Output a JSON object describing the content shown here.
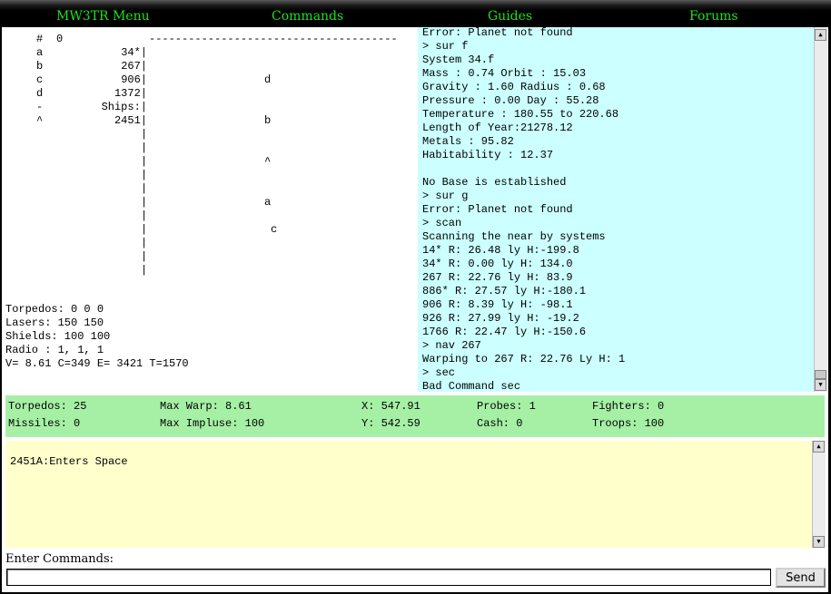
{
  "menu": {
    "items": [
      {
        "label": "MW3TR Menu"
      },
      {
        "label": "Commands"
      },
      {
        "label": "Guides"
      },
      {
        "label": "Forums"
      }
    ]
  },
  "map": {
    "header_hash": "#",
    "header_zero": "0",
    "header_dashes": "--------------------------------------",
    "rows": [
      {
        "key": "a",
        "value": "34*|"
      },
      {
        "key": "b",
        "value": "267|"
      },
      {
        "key": "c",
        "value": "906|"
      },
      {
        "key": "d",
        "value": "1372|"
      },
      {
        "key": "-",
        "value": "Ships:|"
      },
      {
        "key": "^",
        "value": "2451|"
      }
    ],
    "pipe": "|",
    "markers": {
      "d": "d",
      "b": "b",
      "caret": "^",
      "a": "a",
      "c": "c"
    }
  },
  "ship_stats": {
    "torpedos": "Torpedos: 0 0 0",
    "lasers": "Lasers: 150 150",
    "shields": "Shields: 100 100",
    "radio": "Radio : 1, 1, 1",
    "vector": "V= 8.61 C=349 E= 3421 T=1570"
  },
  "log": {
    "lines": [
      "Error: Planet not found",
      "> sur f",
      "System 34.f",
      "Mass : 0.74 Orbit : 15.03",
      "Gravity : 1.60 Radius : 0.68",
      "Pressure : 0.00 Day : 55.28",
      "Temperature : 180.55 to 220.68",
      "Length of Year:21278.12",
      "Metals : 95.82",
      "Habitability : 12.37",
      "",
      "No Base is established",
      "> sur g",
      "Error: Planet not found",
      "> scan",
      "Scanning the near by systems",
      "14* R: 26.48 ly H:-199.8",
      "34* R: 0.00 ly H: 134.0",
      "267 R: 22.76 ly H: 83.9",
      "886* R: 27.57 ly H:-180.1",
      "906 R: 8.39 ly H: -98.1",
      "926 R: 27.99 ly H: -19.2",
      "1766 R: 22.47 ly H:-150.6",
      "> nav 267",
      "Warping to 267 R: 22.76 Ly H: 1",
      "> sec",
      "Bad Command sec"
    ]
  },
  "status": {
    "torpedos": "Torpedos: 25",
    "missiles": "Missiles: 0",
    "max_warp": "Max Warp: 8.61",
    "max_impulse": "Max Impluse: 100",
    "x": "X: 547.91",
    "y": "Y: 542.59",
    "probes": "Probes: 1",
    "cash": "Cash: 0",
    "fighters": "Fighters: 0",
    "troops": "Troops: 100"
  },
  "messages": {
    "lines": [
      "2451A:Enters Space"
    ]
  },
  "command": {
    "label": "Enter Commands:",
    "value": "",
    "send_label": "Send"
  },
  "icons": {
    "scroll_up": "▲",
    "scroll_down": "▼"
  }
}
